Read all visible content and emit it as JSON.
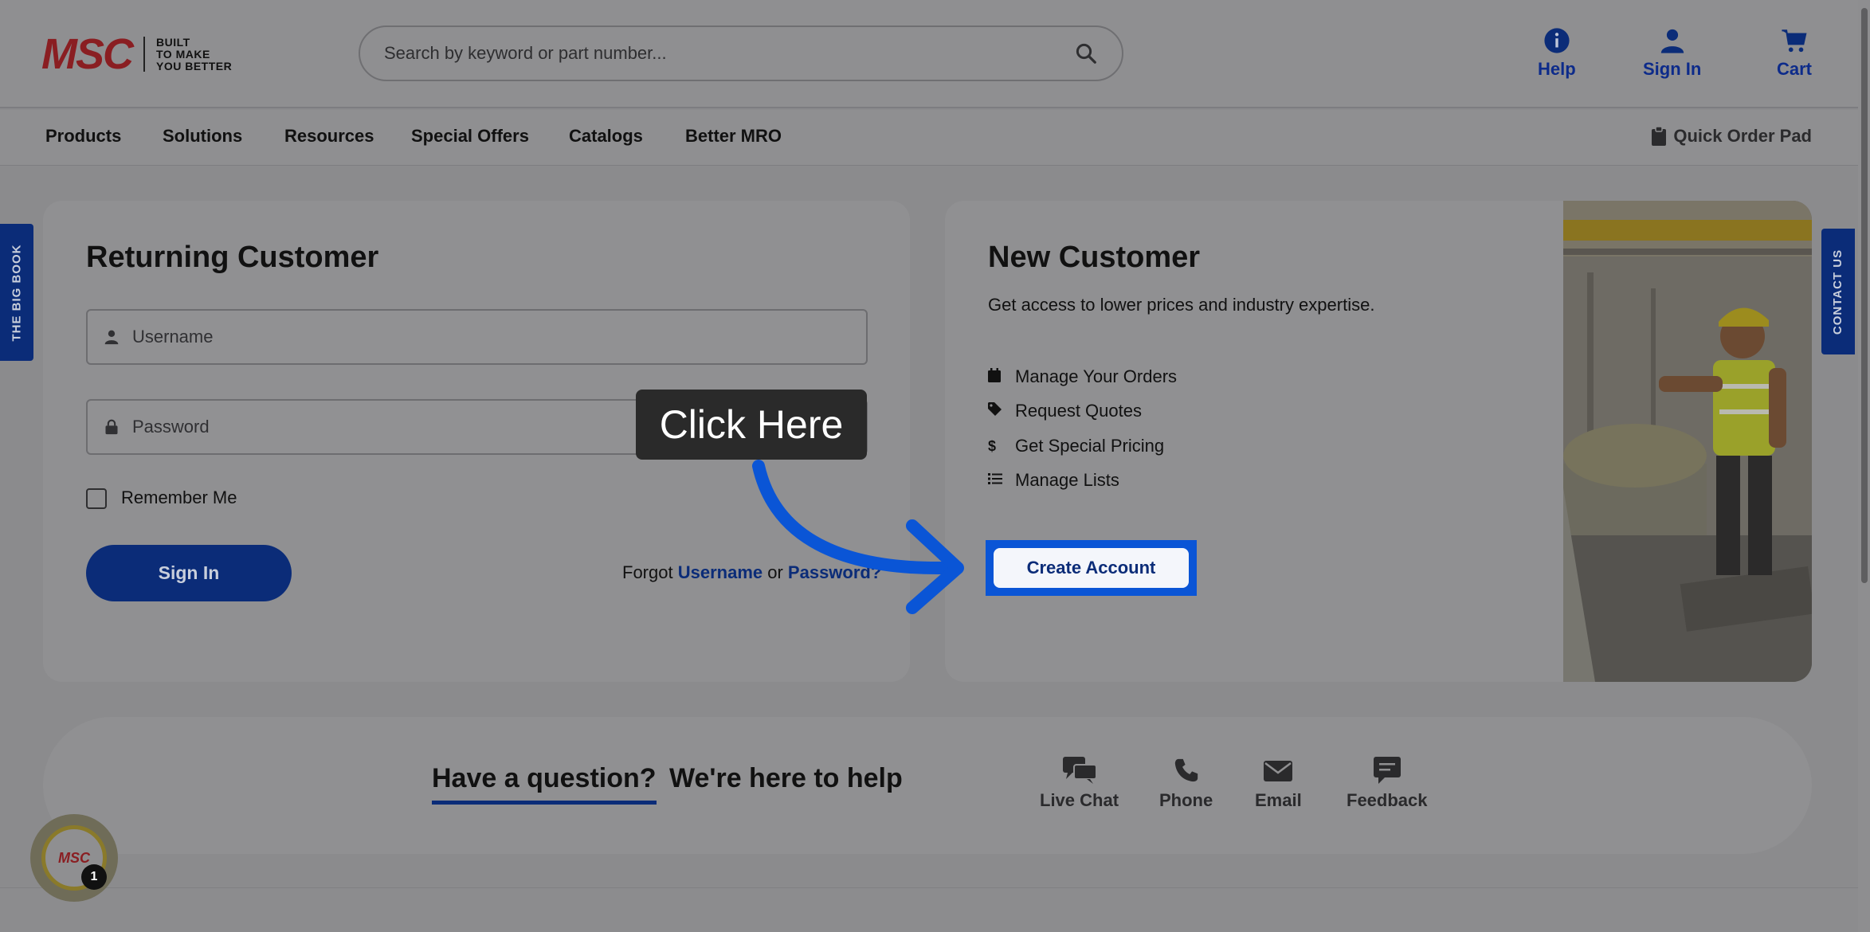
{
  "header": {
    "logo_text": "MSC",
    "logo_tagline": [
      "BUILT",
      "TO MAKE",
      "YOU BETTER"
    ],
    "search_placeholder": "Search by keyword or part number...",
    "help_label": "Help",
    "signin_label": "Sign In",
    "cart_label": "Cart"
  },
  "nav": {
    "items": [
      "Products",
      "Solutions",
      "Resources",
      "Special Offers",
      "Catalogs",
      "Better MRO"
    ],
    "quick_order_label": "Quick Order Pad"
  },
  "side_tabs": {
    "left": "THE BIG BOOK",
    "right": "CONTACT US"
  },
  "returning": {
    "title": "Returning Customer",
    "username_placeholder": "Username",
    "password_placeholder": "Password",
    "remember_label": "Remember Me",
    "signin_button": "Sign In",
    "forgot_prefix": "Forgot",
    "forgot_username": "Username",
    "forgot_or": "or",
    "forgot_password": "Password?"
  },
  "new_customer": {
    "title": "New Customer",
    "subtitle": "Get access to lower prices and industry expertise.",
    "benefits": [
      {
        "icon": "calendar-icon",
        "label": "Manage Your Orders"
      },
      {
        "icon": "tag-icon",
        "label": "Request Quotes"
      },
      {
        "icon": "dollar-icon",
        "label": "Get Special Pricing"
      },
      {
        "icon": "list-icon",
        "label": "Manage Lists"
      }
    ],
    "create_button": "Create Account"
  },
  "tooltip": {
    "text": "Click Here"
  },
  "help_bar": {
    "question": "Have a question?",
    "subtitle": "We're here to help",
    "items": [
      "Live Chat",
      "Phone",
      "Email",
      "Feedback"
    ]
  },
  "chat_badge": {
    "logo": "MSC",
    "count": "1"
  },
  "colors": {
    "brand_blue": "#0b2c78",
    "brand_red": "#8a1e22",
    "highlight": "#0a55d6"
  }
}
